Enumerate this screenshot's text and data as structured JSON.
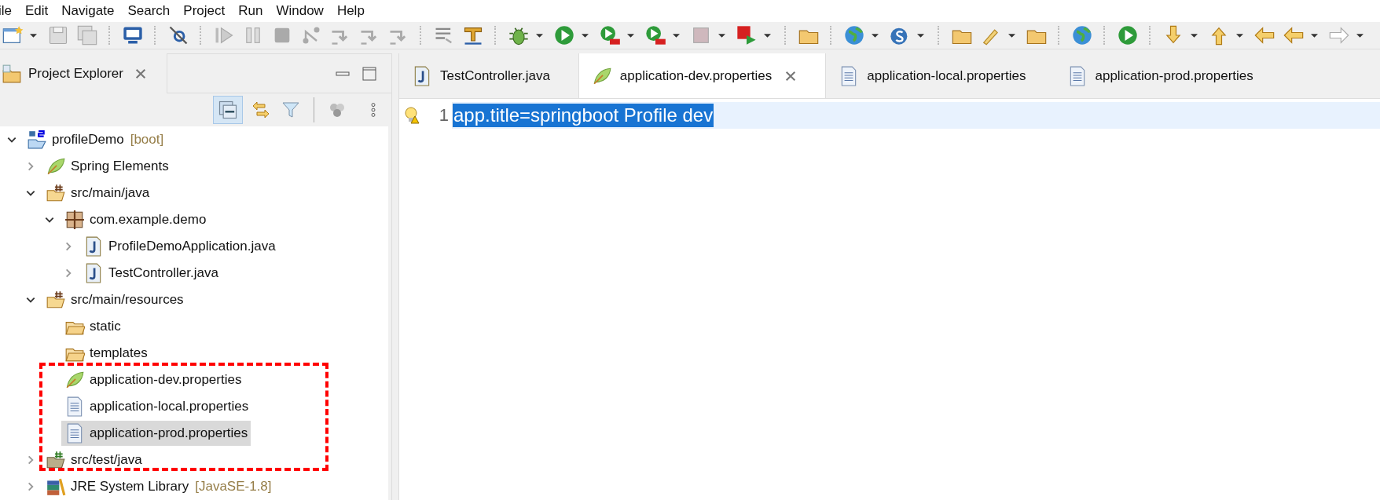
{
  "menu": [
    "ile",
    "Edit",
    "Navigate",
    "Search",
    "Project",
    "Run",
    "Window",
    "Help"
  ],
  "explorer": {
    "title": "Project Explorer",
    "tree": [
      {
        "label": "profileDemo",
        "decoration": "[boot]",
        "kind": "project",
        "expanded": true,
        "selected": false,
        "children": [
          {
            "label": "Spring Elements",
            "kind": "spring",
            "expanded": false,
            "selected": false
          },
          {
            "label": "src/main/java",
            "kind": "source-folder",
            "expanded": true,
            "selected": false,
            "children": [
              {
                "label": "com.example.demo",
                "kind": "package",
                "expanded": true,
                "selected": false,
                "children": [
                  {
                    "label": "ProfileDemoApplication.java",
                    "kind": "java",
                    "expanded": false,
                    "selected": false
                  },
                  {
                    "label": "TestController.java",
                    "kind": "java",
                    "expanded": false,
                    "selected": false
                  }
                ]
              }
            ]
          },
          {
            "label": "src/main/resources",
            "kind": "source-folder",
            "expanded": true,
            "selected": false,
            "children": [
              {
                "label": "static",
                "kind": "folder",
                "selected": false
              },
              {
                "label": "templates",
                "kind": "folder",
                "selected": false
              },
              {
                "label": "application-dev.properties",
                "kind": "spring",
                "selected": false
              },
              {
                "label": "application-local.properties",
                "kind": "properties",
                "selected": false
              },
              {
                "label": "application-prod.properties",
                "kind": "properties",
                "selected": true
              }
            ]
          },
          {
            "label": "src/test/java",
            "kind": "test-folder",
            "expanded": false,
            "selected": false
          },
          {
            "label": "JRE System Library",
            "decoration": "[JavaSE-1.8]",
            "kind": "library",
            "expanded": false,
            "selected": false
          }
        ]
      }
    ]
  },
  "editor": {
    "tabs": [
      {
        "label": "TestController.java",
        "kind": "java",
        "selected": false,
        "closable": false
      },
      {
        "label": "application-dev.properties",
        "kind": "spring",
        "selected": true,
        "closable": true
      },
      {
        "label": "application-local.properties",
        "kind": "properties",
        "selected": false,
        "closable": false
      },
      {
        "label": "application-prod.properties",
        "kind": "properties",
        "selected": false,
        "closable": false
      }
    ],
    "lines": [
      {
        "number": "1",
        "text": "app.title=springboot Profile dev",
        "selected": true,
        "warning": true
      }
    ]
  }
}
